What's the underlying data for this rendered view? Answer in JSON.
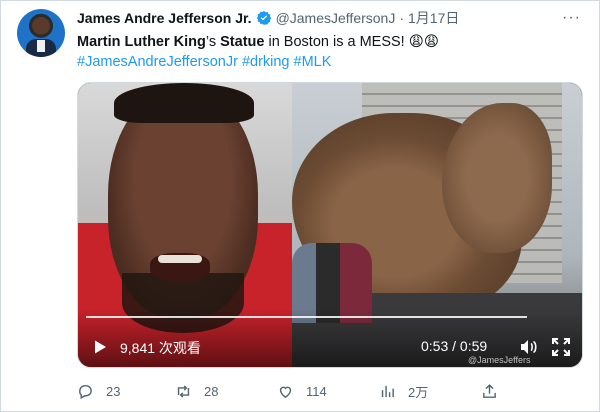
{
  "tweet": {
    "author_name": "James Andre Jefferson Jr.",
    "handle": "@JamesJeffersonJ",
    "separator": "·",
    "date": "1月17日",
    "more_label": "···",
    "text_part1": "Martin Luther King",
    "text_part2": "’s ",
    "text_part3": "Statue",
    "text_part4": " in Boston is a MESS! 😩😩",
    "hashtags": [
      "#JamesAndreJeffersonJr",
      "#drking",
      "#MLK"
    ]
  },
  "video": {
    "views": "9,841 次观看",
    "time": "0:53 / 0:59",
    "progress": 0.9,
    "watermark": "@JamesJeffers"
  },
  "actions": {
    "replies": "23",
    "retweets": "28",
    "likes": "114",
    "views": "2万"
  },
  "colors": {
    "link": "#1d9bf0",
    "secondary": "#536471",
    "verified": "#1d9bf0"
  }
}
